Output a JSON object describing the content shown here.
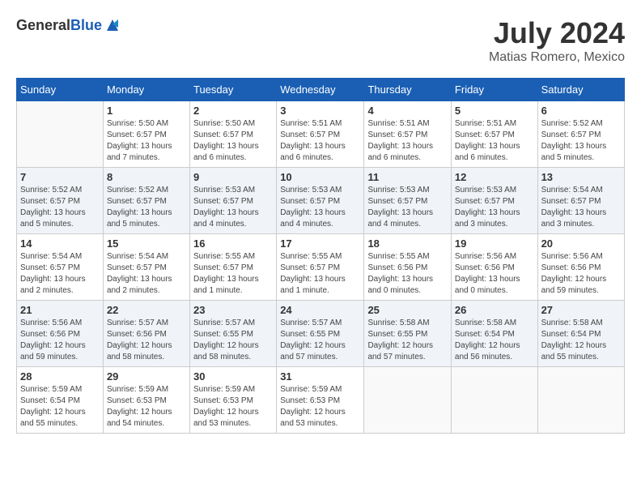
{
  "header": {
    "logo_general": "General",
    "logo_blue": "Blue",
    "title": "July 2024",
    "location": "Matias Romero, Mexico"
  },
  "weekdays": [
    "Sunday",
    "Monday",
    "Tuesday",
    "Wednesday",
    "Thursday",
    "Friday",
    "Saturday"
  ],
  "weeks": [
    {
      "days": [
        {
          "num": "",
          "info": ""
        },
        {
          "num": "1",
          "info": "Sunrise: 5:50 AM\nSunset: 6:57 PM\nDaylight: 13 hours\nand 7 minutes."
        },
        {
          "num": "2",
          "info": "Sunrise: 5:50 AM\nSunset: 6:57 PM\nDaylight: 13 hours\nand 6 minutes."
        },
        {
          "num": "3",
          "info": "Sunrise: 5:51 AM\nSunset: 6:57 PM\nDaylight: 13 hours\nand 6 minutes."
        },
        {
          "num": "4",
          "info": "Sunrise: 5:51 AM\nSunset: 6:57 PM\nDaylight: 13 hours\nand 6 minutes."
        },
        {
          "num": "5",
          "info": "Sunrise: 5:51 AM\nSunset: 6:57 PM\nDaylight: 13 hours\nand 6 minutes."
        },
        {
          "num": "6",
          "info": "Sunrise: 5:52 AM\nSunset: 6:57 PM\nDaylight: 13 hours\nand 5 minutes."
        }
      ]
    },
    {
      "days": [
        {
          "num": "7",
          "info": "Sunrise: 5:52 AM\nSunset: 6:57 PM\nDaylight: 13 hours\nand 5 minutes."
        },
        {
          "num": "8",
          "info": "Sunrise: 5:52 AM\nSunset: 6:57 PM\nDaylight: 13 hours\nand 5 minutes."
        },
        {
          "num": "9",
          "info": "Sunrise: 5:53 AM\nSunset: 6:57 PM\nDaylight: 13 hours\nand 4 minutes."
        },
        {
          "num": "10",
          "info": "Sunrise: 5:53 AM\nSunset: 6:57 PM\nDaylight: 13 hours\nand 4 minutes."
        },
        {
          "num": "11",
          "info": "Sunrise: 5:53 AM\nSunset: 6:57 PM\nDaylight: 13 hours\nand 4 minutes."
        },
        {
          "num": "12",
          "info": "Sunrise: 5:53 AM\nSunset: 6:57 PM\nDaylight: 13 hours\nand 3 minutes."
        },
        {
          "num": "13",
          "info": "Sunrise: 5:54 AM\nSunset: 6:57 PM\nDaylight: 13 hours\nand 3 minutes."
        }
      ]
    },
    {
      "days": [
        {
          "num": "14",
          "info": "Sunrise: 5:54 AM\nSunset: 6:57 PM\nDaylight: 13 hours\nand 2 minutes."
        },
        {
          "num": "15",
          "info": "Sunrise: 5:54 AM\nSunset: 6:57 PM\nDaylight: 13 hours\nand 2 minutes."
        },
        {
          "num": "16",
          "info": "Sunrise: 5:55 AM\nSunset: 6:57 PM\nDaylight: 13 hours\nand 1 minute."
        },
        {
          "num": "17",
          "info": "Sunrise: 5:55 AM\nSunset: 6:57 PM\nDaylight: 13 hours\nand 1 minute."
        },
        {
          "num": "18",
          "info": "Sunrise: 5:55 AM\nSunset: 6:56 PM\nDaylight: 13 hours\nand 0 minutes."
        },
        {
          "num": "19",
          "info": "Sunrise: 5:56 AM\nSunset: 6:56 PM\nDaylight: 13 hours\nand 0 minutes."
        },
        {
          "num": "20",
          "info": "Sunrise: 5:56 AM\nSunset: 6:56 PM\nDaylight: 12 hours\nand 59 minutes."
        }
      ]
    },
    {
      "days": [
        {
          "num": "21",
          "info": "Sunrise: 5:56 AM\nSunset: 6:56 PM\nDaylight: 12 hours\nand 59 minutes."
        },
        {
          "num": "22",
          "info": "Sunrise: 5:57 AM\nSunset: 6:56 PM\nDaylight: 12 hours\nand 58 minutes."
        },
        {
          "num": "23",
          "info": "Sunrise: 5:57 AM\nSunset: 6:55 PM\nDaylight: 12 hours\nand 58 minutes."
        },
        {
          "num": "24",
          "info": "Sunrise: 5:57 AM\nSunset: 6:55 PM\nDaylight: 12 hours\nand 57 minutes."
        },
        {
          "num": "25",
          "info": "Sunrise: 5:58 AM\nSunset: 6:55 PM\nDaylight: 12 hours\nand 57 minutes."
        },
        {
          "num": "26",
          "info": "Sunrise: 5:58 AM\nSunset: 6:54 PM\nDaylight: 12 hours\nand 56 minutes."
        },
        {
          "num": "27",
          "info": "Sunrise: 5:58 AM\nSunset: 6:54 PM\nDaylight: 12 hours\nand 55 minutes."
        }
      ]
    },
    {
      "days": [
        {
          "num": "28",
          "info": "Sunrise: 5:59 AM\nSunset: 6:54 PM\nDaylight: 12 hours\nand 55 minutes."
        },
        {
          "num": "29",
          "info": "Sunrise: 5:59 AM\nSunset: 6:53 PM\nDaylight: 12 hours\nand 54 minutes."
        },
        {
          "num": "30",
          "info": "Sunrise: 5:59 AM\nSunset: 6:53 PM\nDaylight: 12 hours\nand 53 minutes."
        },
        {
          "num": "31",
          "info": "Sunrise: 5:59 AM\nSunset: 6:53 PM\nDaylight: 12 hours\nand 53 minutes."
        },
        {
          "num": "",
          "info": ""
        },
        {
          "num": "",
          "info": ""
        },
        {
          "num": "",
          "info": ""
        }
      ]
    }
  ]
}
